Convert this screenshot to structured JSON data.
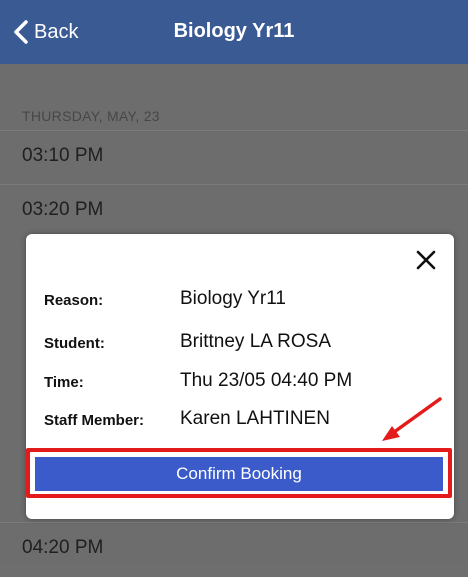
{
  "header": {
    "back_label": "Back",
    "title": "Biology Yr11",
    "back_icon": "chevron-left-icon"
  },
  "list": {
    "date_header": "THURSDAY, MAY, 23",
    "rows": [
      "03:10 PM",
      "03:20 PM",
      "04:20 PM"
    ]
  },
  "modal": {
    "close_icon": "close-icon",
    "details": [
      {
        "label": "Reason:",
        "value": "Biology Yr11"
      },
      {
        "label": "Student:",
        "value": "Brittney LA ROSA"
      },
      {
        "label": "Time:",
        "value": "Thu 23/05 04:40 PM"
      },
      {
        "label": "Staff Member:",
        "value": "Karen LAHTINEN"
      }
    ],
    "confirm_label": "Confirm Booking"
  },
  "annotation": {
    "highlight_color": "#e41b1b",
    "arrow_icon": "red-arrow-icon"
  },
  "colors": {
    "header_bg": "#3a5a93",
    "confirm_bg": "#3a5bc9"
  }
}
